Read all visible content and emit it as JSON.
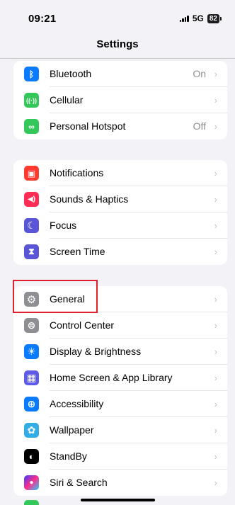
{
  "status_bar": {
    "time": "09:21",
    "network": "5G",
    "battery": "82"
  },
  "nav": {
    "title": "Settings"
  },
  "groups": [
    {
      "rows": [
        {
          "label": "Bluetooth",
          "value": "On",
          "icon": "bluetooth-icon",
          "color": "#0a7aff",
          "glyph": "ᛒ"
        },
        {
          "label": "Cellular",
          "value": "",
          "icon": "cellular-icon",
          "color": "#34c759",
          "glyph": "((·))"
        },
        {
          "label": "Personal Hotspot",
          "value": "Off",
          "icon": "hotspot-icon",
          "color": "#34c759",
          "glyph": "∞"
        }
      ]
    },
    {
      "rows": [
        {
          "label": "Notifications",
          "value": "",
          "icon": "notifications-icon",
          "color": "#ff3b30",
          "glyph": "▣"
        },
        {
          "label": "Sounds & Haptics",
          "value": "",
          "icon": "sounds-icon",
          "color": "#ff2d55",
          "glyph": "◀)"
        },
        {
          "label": "Focus",
          "value": "",
          "icon": "focus-moon-icon",
          "color": "#5856d6",
          "glyph": "☾"
        },
        {
          "label": "Screen Time",
          "value": "",
          "icon": "screen-time-hourglass-icon",
          "color": "#5856d6",
          "glyph": "⧗"
        }
      ]
    },
    {
      "rows": [
        {
          "label": "General",
          "value": "",
          "icon": "gear-icon",
          "color": "#8e8e93",
          "glyph": "⚙"
        },
        {
          "label": "Control Center",
          "value": "",
          "icon": "control-center-icon",
          "color": "#8e8e93",
          "glyph": "⊜"
        },
        {
          "label": "Display & Brightness",
          "value": "",
          "icon": "brightness-icon",
          "color": "#0a7aff",
          "glyph": "☀"
        },
        {
          "label": "Home Screen & App Library",
          "value": "",
          "icon": "home-screen-icon",
          "color": "#5e5ce6",
          "glyph": "▦"
        },
        {
          "label": "Accessibility",
          "value": "",
          "icon": "accessibility-icon",
          "color": "#0a7aff",
          "glyph": "⊕"
        },
        {
          "label": "Wallpaper",
          "value": "",
          "icon": "wallpaper-flower-icon",
          "color": "#32ade6",
          "glyph": "✿"
        },
        {
          "label": "StandBy",
          "value": "",
          "icon": "standby-icon",
          "color": "#000000",
          "glyph": "◐"
        },
        {
          "label": "Siri & Search",
          "value": "",
          "icon": "siri-icon",
          "color": "#1c1c1e",
          "glyph": "●"
        }
      ]
    }
  ],
  "chevron": "›"
}
